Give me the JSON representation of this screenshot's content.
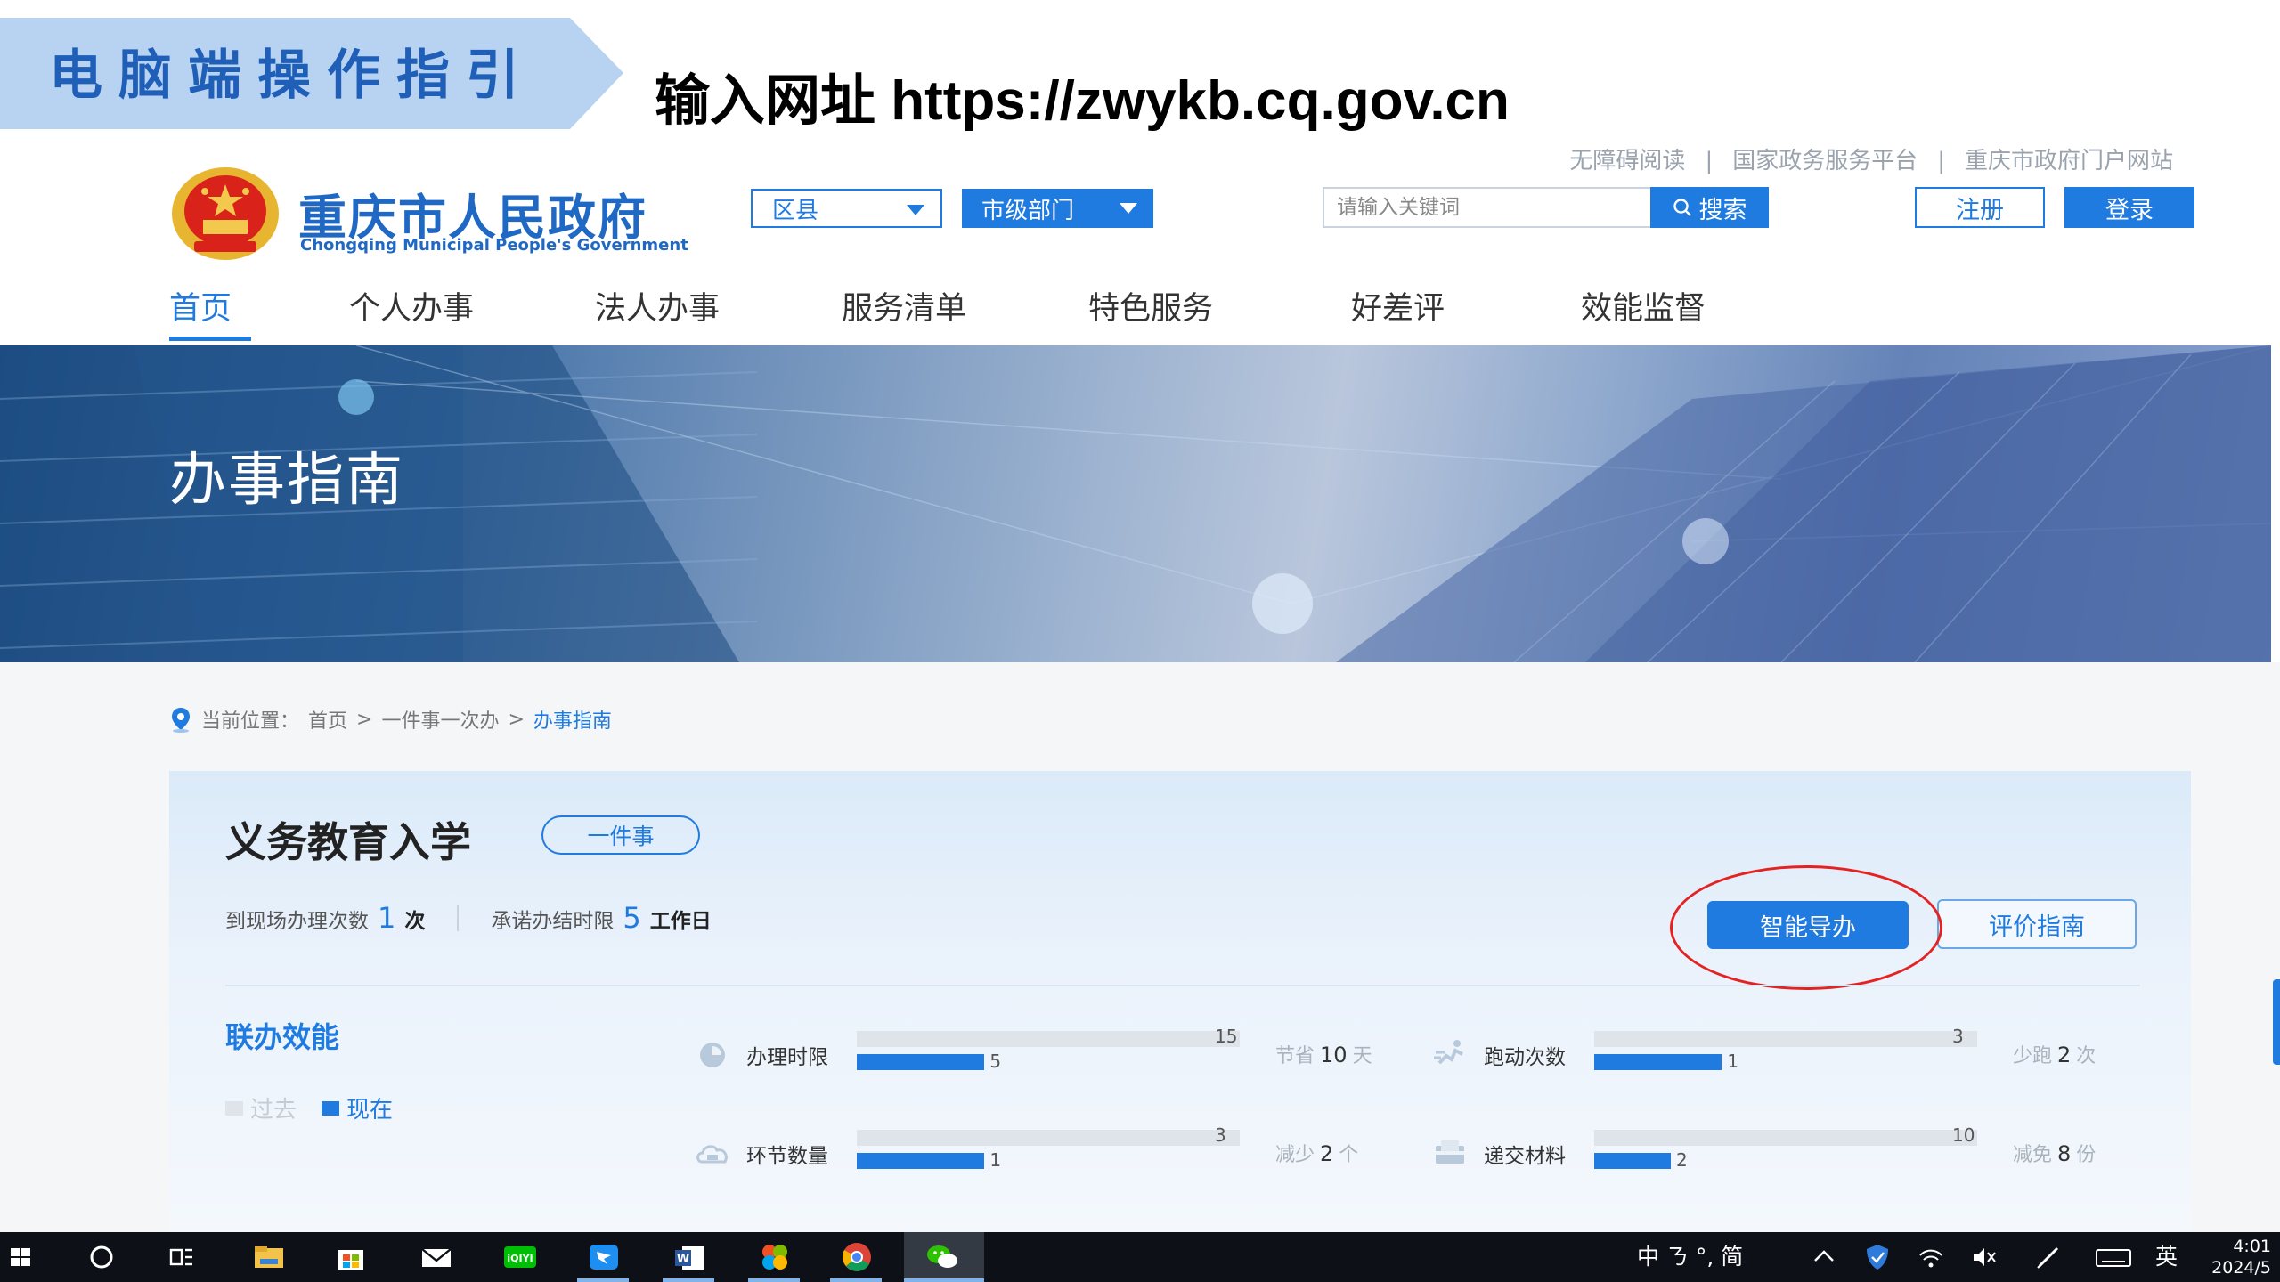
{
  "guide": {
    "title": "电脑端操作指引",
    "url_text": "输入网址  https://zwykb.cq.gov.cn"
  },
  "top_links": [
    "无障碍阅读",
    "国家政务服务平台",
    "重庆市政府门户网站"
  ],
  "top_links_sep": "|",
  "logo": {
    "cn": "重庆市人民政府",
    "en": "Chongqing Municipal People's Government"
  },
  "selects": {
    "district": "区县",
    "department": "市级部门"
  },
  "search": {
    "placeholder": "请输入关键词",
    "button": "搜索"
  },
  "auth": {
    "register": "注册",
    "login": "登录"
  },
  "nav": [
    {
      "label": "首页",
      "active": true
    },
    {
      "label": "个人办事"
    },
    {
      "label": "法人办事"
    },
    {
      "label": "服务清单"
    },
    {
      "label": "特色服务"
    },
    {
      "label": "好差评"
    },
    {
      "label": "效能监督"
    }
  ],
  "hero": {
    "title": "办事指南"
  },
  "breadcrumb": {
    "prefix": "当前位置：",
    "items": [
      "首页",
      ">",
      "一件事一次办",
      ">",
      "办事指南"
    ]
  },
  "card": {
    "title": "义务教育入学",
    "tag": "一件事",
    "stats": {
      "visits_label": "到现场办理次数",
      "visits_value": "1",
      "visits_unit": "次",
      "limit_label": "承诺办结时限",
      "limit_value": "5",
      "limit_unit": "工作日"
    },
    "buttons": {
      "smart_guide": "智能导办",
      "evaluate": "评价指南"
    },
    "section_title": "联办效能",
    "legend": {
      "past": "过去",
      "now": "现在"
    },
    "metrics": [
      {
        "label": "办理时限",
        "icon": "clock-icon",
        "past": 15,
        "now": 5,
        "save_prefix": "节省",
        "save_value": "10",
        "save_unit": "天",
        "max": 15
      },
      {
        "label": "跑动次数",
        "icon": "runner-icon",
        "past": 3,
        "now": 1,
        "save_prefix": "少跑",
        "save_value": "2",
        "save_unit": "次",
        "max": 3
      },
      {
        "label": "环节数量",
        "icon": "cloud-steps-icon",
        "past": 3,
        "now": 1,
        "save_prefix": "减少",
        "save_value": "2",
        "save_unit": "个",
        "max": 3
      },
      {
        "label": "递交材料",
        "icon": "documents-icon",
        "past": 10,
        "now": 2,
        "save_prefix": "减免",
        "save_value": "8",
        "save_unit": "份",
        "max": 10
      }
    ]
  },
  "colors": {
    "brand_blue": "#1f7be0",
    "annotation_red": "#e52222",
    "bar_past": "#dfe3ea"
  },
  "taskbar": {
    "tray_ime": "中 ㄋ °, 简",
    "tray_lang": "英",
    "time": "4:01",
    "date": "2024/5"
  }
}
